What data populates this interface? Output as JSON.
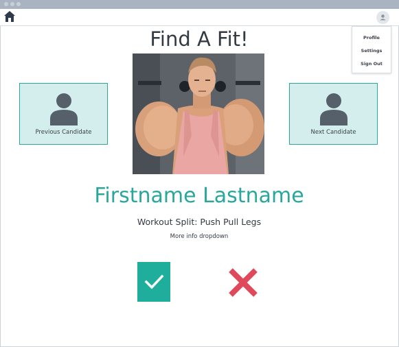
{
  "app": {
    "title": "Find A Fit!"
  },
  "menu": {
    "items": [
      "Profile",
      "Settings",
      "Sign Out"
    ]
  },
  "candidates": {
    "previous_label": "Previous Candidate",
    "next_label": "Next Candidate"
  },
  "profile": {
    "name": "Firstname Lastname",
    "workout_split": "Workout Split: Push Pull Legs",
    "more_info": "More info dropdown"
  },
  "icons": {
    "home": "home-icon",
    "user": "user-icon",
    "accept": "checkmark-icon",
    "reject": "x-icon"
  },
  "colors": {
    "accent": "#2aa79b",
    "accept": "#20ae9c",
    "reject": "#e0495b",
    "candidate_bg": "#d3eeed"
  }
}
